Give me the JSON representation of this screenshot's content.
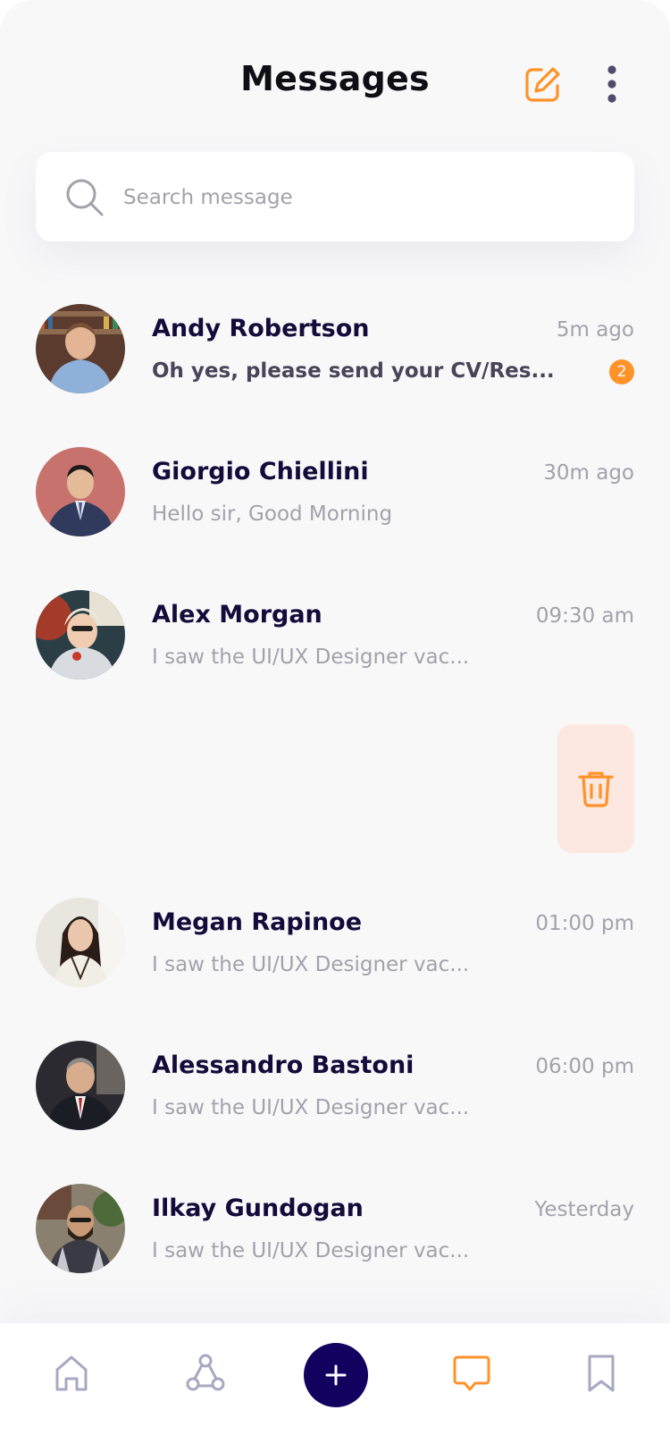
{
  "header": {
    "title": "Messages"
  },
  "search": {
    "placeholder": "Search message"
  },
  "conversations": [
    {
      "name": "Andy Robertson",
      "time": "5m ago",
      "preview": "Oh yes, please send your CV/Res...",
      "unread": "2"
    },
    {
      "name": "Giorgio Chiellini",
      "time": "30m ago",
      "preview": "Hello sir, Good Morning"
    },
    {
      "name": "Alex Morgan",
      "time": "09:30 am",
      "preview": "I saw the UI/UX Designer vac..."
    },
    {
      "name": "Megan Rapinoe",
      "time": "01:00 pm",
      "preview": "I saw the UI/UX Designer vac..."
    },
    {
      "name": "Alessandro Bastoni",
      "time": "06:00 pm",
      "preview": "I saw the UI/UX Designer vac..."
    },
    {
      "name": "Ilkay Gundogan",
      "time": "Yesterday",
      "preview": "I saw the UI/UX Designer vac..."
    }
  ],
  "swipe_action": {
    "icon": "trash-icon"
  },
  "bottom_nav": {
    "items": [
      "home-icon",
      "network-icon",
      "plus-icon",
      "chat-icon",
      "bookmark-icon"
    ],
    "active": "chat-icon"
  },
  "colors": {
    "accent": "#FF9228",
    "primary": "#130160",
    "text_primary": "#140B3A",
    "text_muted": "#A3A1AB",
    "trash_bg": "#FCE8E0"
  }
}
